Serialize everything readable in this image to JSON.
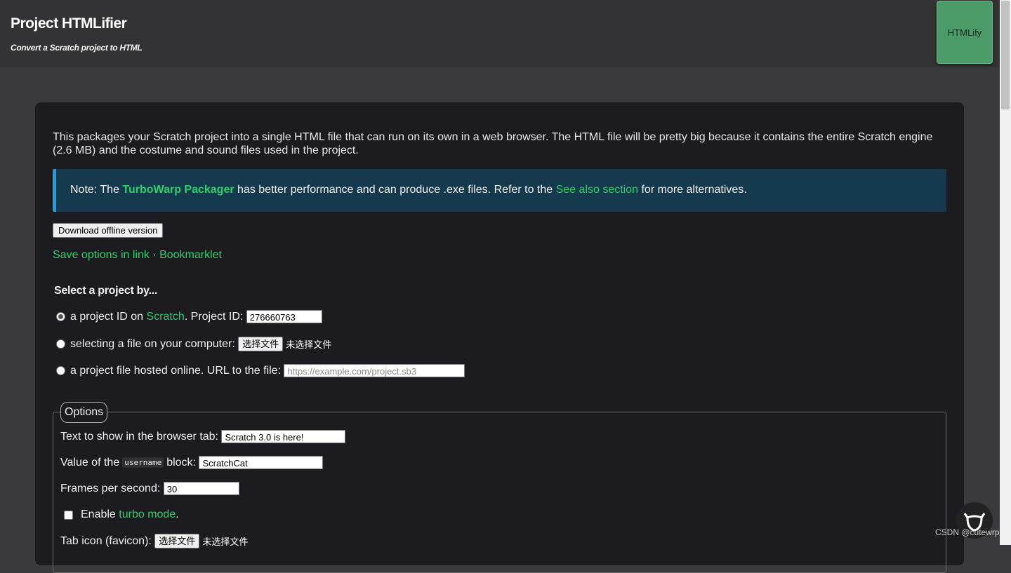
{
  "header": {
    "title": "Project HTMLifier",
    "subtitle": "Convert a Scratch project to HTML",
    "htmlify_button": "HTMLify"
  },
  "intro": "This packages your Scratch project into a single HTML file that can run on its own in a web browser. The HTML file will be pretty big because it contains the entire Scratch engine (2.6 MB) and the costume and sound files used in the project.",
  "note": {
    "prefix": "Note: The ",
    "link1": "TurboWarp Packager",
    "middle": " has better performance and can produce .exe files. Refer to the ",
    "link2": "See also section",
    "suffix": " for more alternatives."
  },
  "download_button": "Download offline version",
  "links": {
    "save_options": "Save options in link",
    "separator": " · ",
    "bookmarklet": "Bookmarklet"
  },
  "select": {
    "heading": "Select a project by...",
    "option_id": {
      "prefix": "a project ID on ",
      "link": "Scratch",
      "suffix": ". Project ID: ",
      "value": "276660763"
    },
    "option_file": {
      "label": "selecting a file on your computer: ",
      "button": "选择文件",
      "status": "未选择文件"
    },
    "option_url": {
      "label": "a project file hosted online. URL to the file: ",
      "placeholder": "https://example.com/project.sb3"
    }
  },
  "options": {
    "legend": "Options",
    "tab_text": {
      "label": "Text to show in the browser tab: ",
      "value": "Scratch 3.0 is here!"
    },
    "username": {
      "prefix": "Value of the ",
      "code": "username",
      "suffix": " block: ",
      "value": "ScratchCat"
    },
    "fps": {
      "label": "Frames per second: ",
      "value": "30"
    },
    "turbo": {
      "prefix": "Enable ",
      "link": "turbo mode",
      "suffix": "."
    },
    "favicon": {
      "label": "Tab icon (favicon): ",
      "button": "选择文件",
      "status": "未选择文件"
    }
  },
  "watermark": "CSDN @cutewrp",
  "colors": {
    "accent_link": "#2ed06a",
    "note_bg": "#163a4d",
    "htmlify_bg": "#4a9b68"
  }
}
